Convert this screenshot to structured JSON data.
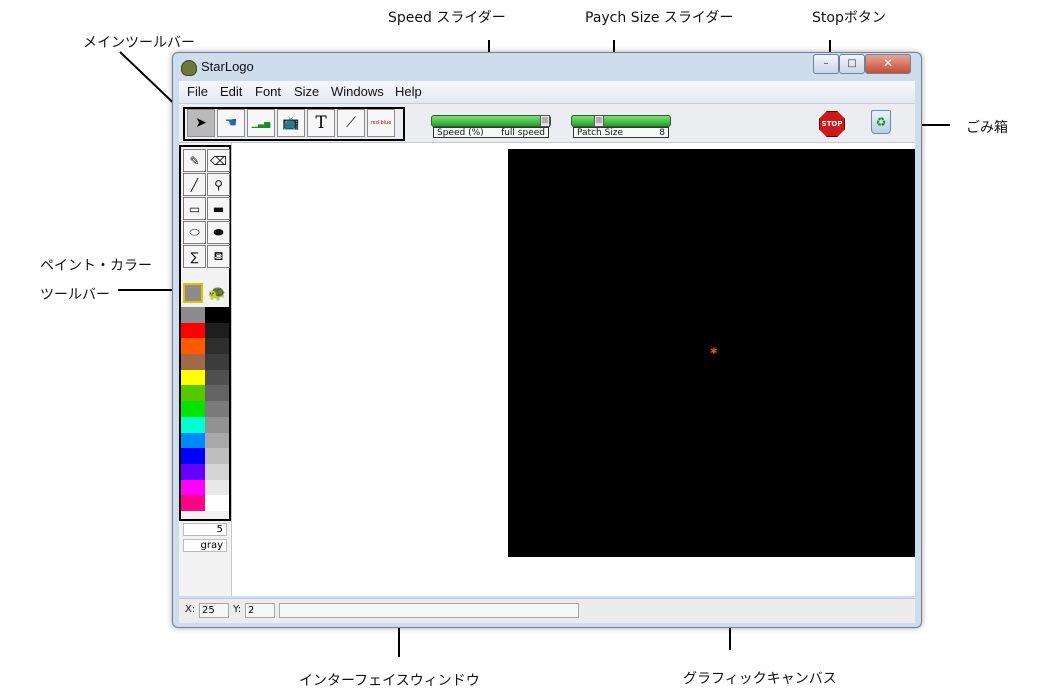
{
  "callouts": {
    "main_toolbar": "メインツールバー",
    "speed_slider": "Speed スライダー",
    "patch_slider": "Paych Size スライダー",
    "stop_button": "Stopボタン",
    "trash": "ごみ箱",
    "paint_toolbar_line1": "ペイント・カラー",
    "paint_toolbar_line2": "ツールバー",
    "interface_window": "インターフェイスウィンドウ",
    "graphics_canvas": "グラフィックキャンバス"
  },
  "window": {
    "title": "StarLogo",
    "minimize": "–",
    "maximize": "□",
    "close": "✕"
  },
  "menu": [
    "File",
    "Edit",
    "Font",
    "Size",
    "Windows",
    "Help"
  ],
  "toolbar": {
    "tools": [
      {
        "icon": "arrow-pointer-icon",
        "glyph": "➤"
      },
      {
        "icon": "button-tool-icon",
        "glyph": "☚"
      },
      {
        "icon": "slider-tool-icon",
        "glyph": "▁▃▅"
      },
      {
        "icon": "monitor-tool-icon",
        "glyph": "📺"
      },
      {
        "icon": "text-tool-icon",
        "glyph": "T"
      },
      {
        "icon": "graph-tool-icon",
        "glyph": "⟋"
      },
      {
        "icon": "legend-tool-icon",
        "glyph": "red blue"
      }
    ],
    "speed_label": "Speed (%)",
    "speed_value": "full speed",
    "speed_level_percent": 100,
    "patch_label": "Patch Size",
    "patch_value": "8",
    "stop_label": "STOP"
  },
  "paint": {
    "tools": [
      {
        "icon": "pencil-icon",
        "glyph": "✎"
      },
      {
        "icon": "eraser-icon",
        "glyph": "⌫"
      },
      {
        "icon": "line-icon",
        "glyph": "╱"
      },
      {
        "icon": "eyedropper-icon",
        "glyph": "⚲"
      },
      {
        "icon": "rectangle-outline-icon",
        "glyph": "▭"
      },
      {
        "icon": "rectangle-filled-icon",
        "glyph": "▬"
      },
      {
        "icon": "ellipse-outline-icon",
        "glyph": "⬭"
      },
      {
        "icon": "ellipse-filled-icon",
        "glyph": "⬬"
      },
      {
        "icon": "sum-icon",
        "glyph": "∑"
      },
      {
        "icon": "paint-bucket-icon",
        "glyph": "⛾"
      }
    ],
    "colors_left": [
      "#8c8c8c",
      "#ff0000",
      "#ff5a00",
      "#a0694a",
      "#ffff00",
      "#55c800",
      "#00e400",
      "#00ffd2",
      "#0088ff",
      "#0000ff",
      "#6600ff",
      "#ff00ff",
      "#ff0088"
    ],
    "colors_right": [
      "#000000",
      "#1e1e1e",
      "#2e2e2e",
      "#3c3c3c",
      "#505050",
      "#646464",
      "#7a7a7a",
      "#929292",
      "#a8a8a8",
      "#bebebe",
      "#d4d4d4",
      "#e8e8e8",
      "#ffffff"
    ],
    "current_color": "#8c8c8c",
    "brush_size": "5",
    "color_name": "gray"
  },
  "status": {
    "x_label": "X:",
    "x_value": "25",
    "y_label": "Y:",
    "y_value": "2",
    "message": ""
  },
  "colors": {
    "canvas": "#000000",
    "turtle": "#e44a1a"
  }
}
